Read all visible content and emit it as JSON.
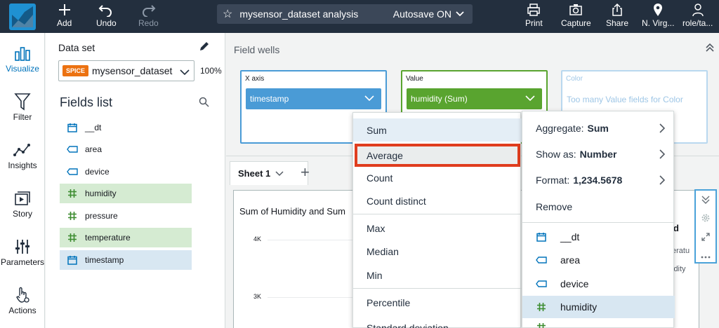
{
  "toolbar": {
    "add": "Add",
    "undo": "Undo",
    "redo": "Redo",
    "analysis_name": "mysensor_dataset analysis",
    "autosave": "Autosave ON",
    "print": "Print",
    "capture": "Capture",
    "share": "Share",
    "region": "N. Virg...",
    "user": "role/ta..."
  },
  "nav": {
    "visualize": "Visualize",
    "filter": "Filter",
    "insights": "Insights",
    "story": "Story",
    "parameters": "Parameters",
    "actions": "Actions"
  },
  "dataset": {
    "label": "Data set",
    "badge": "SPICE",
    "name": "mysensor_dataset",
    "percent": "100%"
  },
  "fields_list": {
    "title": "Fields list",
    "items": [
      {
        "name": "__dt",
        "type": "date"
      },
      {
        "name": "area",
        "type": "dimension"
      },
      {
        "name": "device",
        "type": "dimension"
      },
      {
        "name": "humidity",
        "type": "measure"
      },
      {
        "name": "pressure",
        "type": "measure"
      },
      {
        "name": "temperature",
        "type": "measure"
      },
      {
        "name": "timestamp",
        "type": "date"
      }
    ]
  },
  "wells": {
    "title": "Field wells",
    "xaxis_label": "X axis",
    "xaxis_field": "timestamp",
    "value_label": "Value",
    "value_field": "humidity (Sum)",
    "color_label": "Color",
    "color_placeholder": "Too many Value fields for Color"
  },
  "sheet": {
    "tab": "Sheet 1"
  },
  "visual": {
    "title": "Sum of Humidity and Sum",
    "y_ticks": [
      "4K",
      "3K"
    ],
    "legend_fragment": "d",
    "legend_line1": "eratu",
    "legend_line2": "idity"
  },
  "aggregate_menu": {
    "items": [
      "Sum",
      "Average",
      "Count",
      "Count distinct",
      "Max",
      "Median",
      "Min",
      "Percentile",
      "Standard deviation"
    ]
  },
  "field_menu": {
    "aggregate_label": "Aggregate:",
    "aggregate_value": "Sum",
    "show_as_label": "Show as:",
    "show_as_value": "Number",
    "format_label": "Format:",
    "format_value": "1,234.5678",
    "remove": "Remove",
    "fields": [
      "__dt",
      "area",
      "device",
      "humidity"
    ]
  },
  "colors": {
    "topbar": "#232f3e",
    "accent_blue": "#0073bb",
    "xaxis_pill": "#4a9bd6",
    "value_pill": "#59a42f",
    "highlight_border": "#e03d1e"
  }
}
